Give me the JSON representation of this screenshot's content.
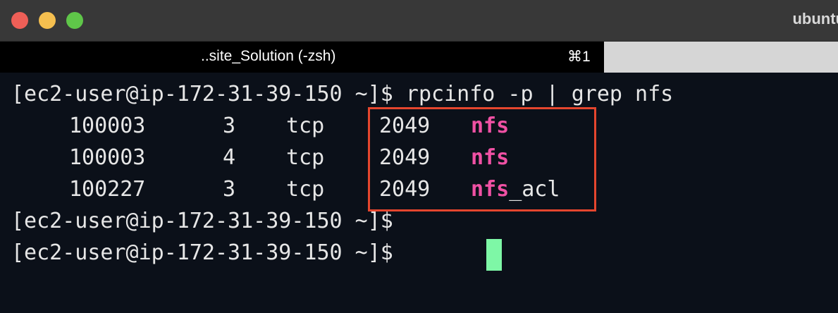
{
  "window": {
    "title": "ubuntu",
    "controls": [
      "close",
      "minimize",
      "zoom"
    ]
  },
  "tabs": [
    {
      "label": "..site_Solution (-zsh)",
      "shortcut": "⌘1",
      "active": true
    },
    {
      "label": "",
      "active": false
    }
  ],
  "terminal": {
    "command_line": {
      "prompt": "[ec2-user@ip-172-31-39-150 ~]$ ",
      "command": "rpcinfo -p | grep nfs"
    },
    "rows": [
      {
        "program": "100003",
        "version": "3",
        "proto": "tcp",
        "port": "2049",
        "service_match": "nfs",
        "service_rest": ""
      },
      {
        "program": "100003",
        "version": "4",
        "proto": "tcp",
        "port": "2049",
        "service_match": "nfs",
        "service_rest": ""
      },
      {
        "program": "100227",
        "version": "3",
        "proto": "tcp",
        "port": "2049",
        "service_match": "nfs",
        "service_rest": "_acl"
      }
    ],
    "prompts": [
      "[ec2-user@ip-172-31-39-150 ~]$",
      "[ec2-user@ip-172-31-39-150 ~]$ "
    ],
    "highlight_color": "#f051a4",
    "cursor_color": "#7ef7a6",
    "annotation_color": "#e5462e"
  }
}
